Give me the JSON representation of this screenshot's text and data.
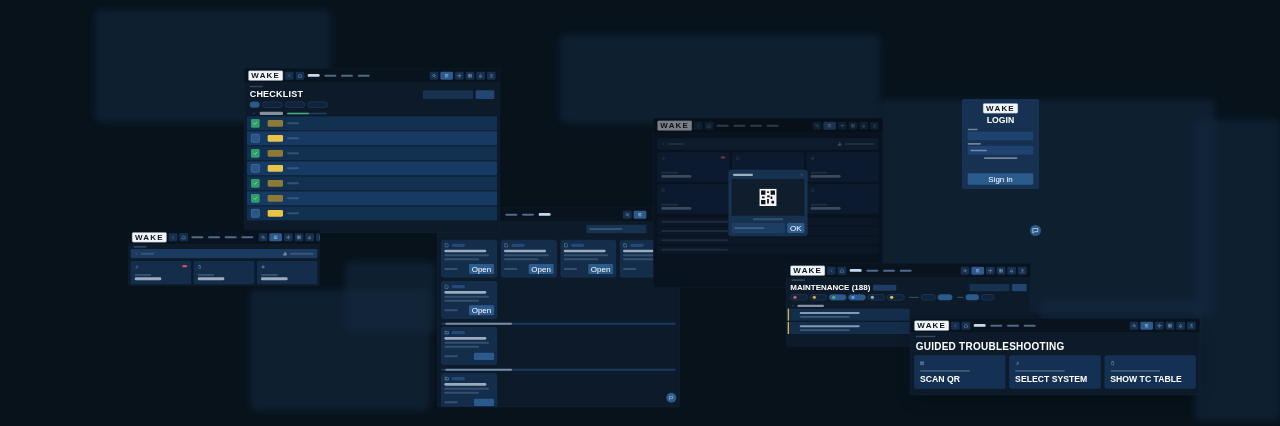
{
  "checklist_screen": {
    "header": {
      "logo": "WAKE",
      "nav": [
        {
          "selected": true
        },
        {
          "selected": false
        },
        {
          "selected": false
        },
        {
          "selected": false
        }
      ]
    },
    "title": "CHECKLIST",
    "chips": [
      {
        "selected": true
      },
      {
        "selected": false
      },
      {
        "selected": false
      },
      {
        "selected": false
      }
    ],
    "section": {
      "level": 0.55
    },
    "rows": [
      {
        "checked": true
      },
      {
        "checked": false
      },
      {
        "checked": true
      },
      {
        "checked": false
      },
      {
        "checked": true
      },
      {
        "checked": true
      },
      {
        "checked": false
      }
    ]
  },
  "dashboard_screen": {
    "header": {
      "logo": "WAKE",
      "nav": [
        {
          "selected": false
        },
        {
          "selected": false
        },
        {
          "selected": false
        },
        {
          "selected": false
        }
      ]
    },
    "cards": [
      {
        "alert": true
      },
      {
        "alert": false
      },
      {
        "alert": false
      }
    ]
  },
  "documents_screen": {
    "header": {
      "nav": [
        {
          "selected": false
        },
        {
          "selected": false
        },
        {
          "selected": true
        }
      ]
    },
    "cards": [
      {
        "kind": "document",
        "button": "Open"
      },
      {
        "kind": "document",
        "button": "Open"
      },
      {
        "kind": "document",
        "button": "Open"
      },
      {
        "kind": "document"
      },
      {
        "kind": "document",
        "button": "Open"
      }
    ],
    "groups": [
      {
        "cards": [
          {
            "kind": "photo"
          }
        ]
      },
      {
        "cards": [
          {
            "kind": "photo"
          }
        ]
      }
    ]
  },
  "home_screen": {
    "header": {
      "logo": "WAKE",
      "nav": [
        {
          "selected": false
        },
        {
          "selected": false
        },
        {
          "selected": false
        },
        {
          "selected": false
        }
      ]
    },
    "cards": [
      {
        "alert": true
      },
      {
        "alert": false
      },
      {
        "alert": false
      },
      {
        "alert": false
      },
      {
        "alert": false
      }
    ],
    "modal": {
      "button": "OK"
    }
  },
  "login_screen": {
    "logo": "WAKE",
    "title": "LOGIN",
    "button": "Sign in"
  },
  "maintenance_screen": {
    "header": {
      "logo": "WAKE",
      "nav": [
        {
          "selected": true
        },
        {
          "selected": false
        },
        {
          "selected": false
        },
        {
          "selected": false
        }
      ]
    },
    "title": "MAINTENANCE (188)",
    "status_chips": [
      {
        "selected": false,
        "color": "#e05252"
      },
      {
        "selected": false,
        "color": "#e0a040"
      },
      {
        "selected": true,
        "color": "#4caf7d"
      },
      {
        "selected": true,
        "color": "#5aa0e6"
      },
      {
        "selected": false,
        "color": "#9aa7b5"
      },
      {
        "selected": false,
        "color": "#d9c04a"
      }
    ],
    "group_options": [
      {
        "selected": false
      },
      {
        "selected": true
      }
    ],
    "view_options": [
      {
        "selected": true
      },
      {
        "selected": false
      }
    ],
    "jobs": [
      {
        "flagged": true
      },
      {
        "flagged": true
      }
    ]
  },
  "troubleshooting_screen": {
    "header": {
      "logo": "WAKE",
      "nav": [
        {
          "selected": true
        },
        {
          "selected": false
        },
        {
          "selected": false
        },
        {
          "selected": false
        }
      ]
    },
    "title": "GUIDED TROUBLESHOOTING",
    "cards": [
      {
        "kind": "qr",
        "title": "SCAN QR"
      },
      {
        "kind": "system",
        "title": "SELECT SYSTEM"
      },
      {
        "kind": "table",
        "title": "SHOW TC TABLE"
      }
    ]
  }
}
